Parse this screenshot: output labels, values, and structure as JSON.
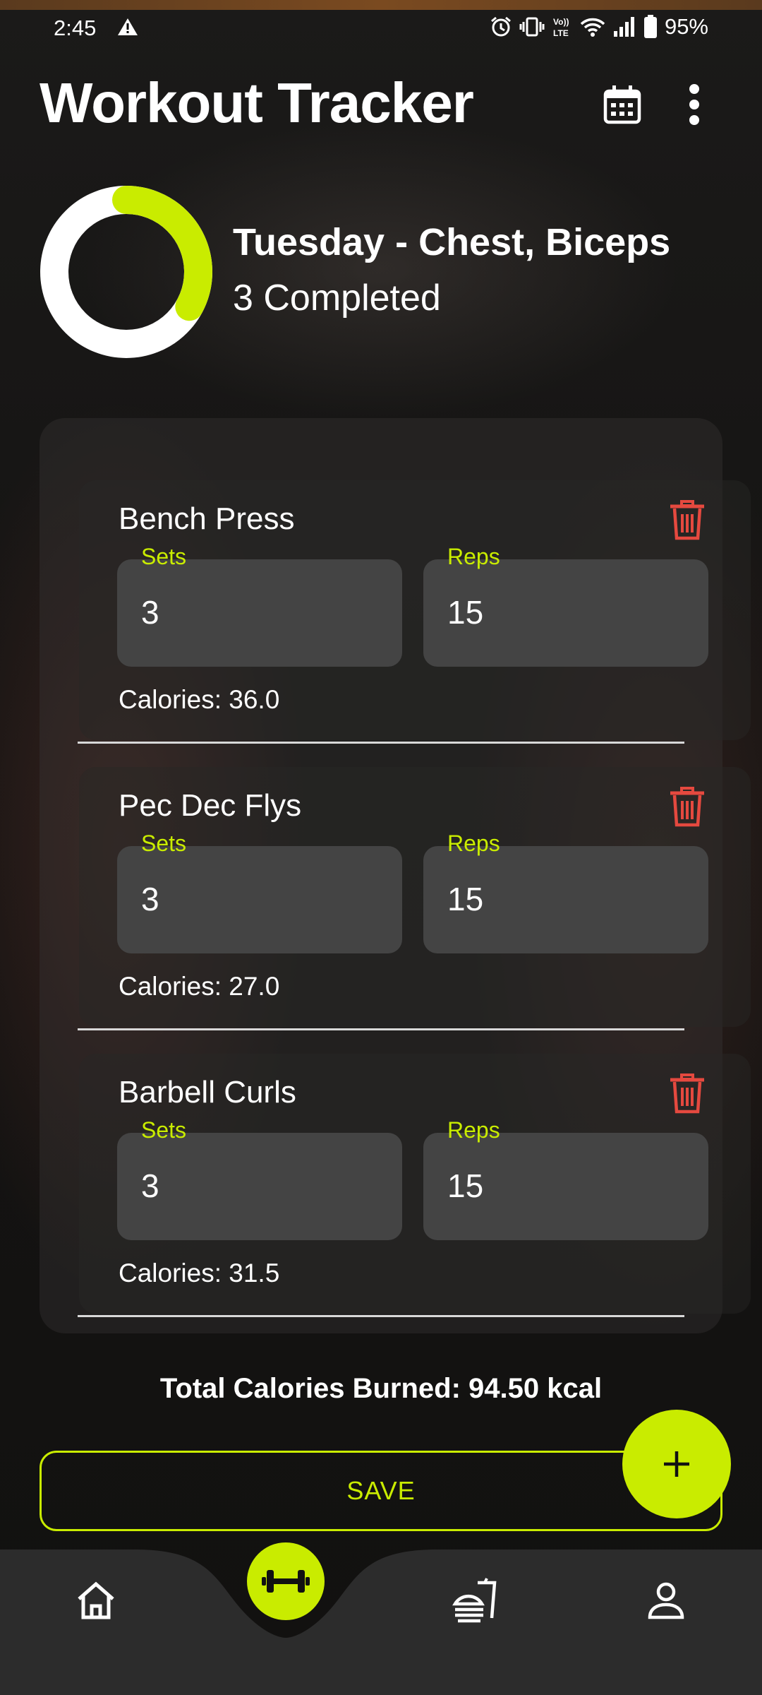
{
  "status_bar": {
    "time": "2:45",
    "battery": "95%"
  },
  "app": {
    "title": "Workout Tracker"
  },
  "summary": {
    "day_title": "Tuesday - Chest, Biceps",
    "completed_text": "3 Completed",
    "progress_fraction": 0.33
  },
  "labels": {
    "sets": "Sets",
    "reps": "Reps"
  },
  "exercises": [
    {
      "name": "Bench Press",
      "sets": "3",
      "reps": "15",
      "calories": "Calories: 36.0"
    },
    {
      "name": "Pec Dec Flys",
      "sets": "3",
      "reps": "15",
      "calories": "Calories: 27.0"
    },
    {
      "name": "Barbell Curls",
      "sets": "3",
      "reps": "15",
      "calories": "Calories: 31.5"
    }
  ],
  "total_text": "Total Calories Burned: 94.50 kcal",
  "save_label": "SAVE",
  "icons": [
    "warning-icon",
    "alarm-icon",
    "vibrate-icon",
    "volte-icon",
    "wifi-icon",
    "signal-icon",
    "battery-icon",
    "calendar-icon",
    "more-vert-icon",
    "trash-icon",
    "plus-icon",
    "home-icon",
    "dumbbell-icon",
    "meal-icon",
    "profile-icon"
  ],
  "colors": {
    "accent": "#c9ec00",
    "danger": "#e5493f",
    "field": "#444444",
    "background": "#141312"
  }
}
